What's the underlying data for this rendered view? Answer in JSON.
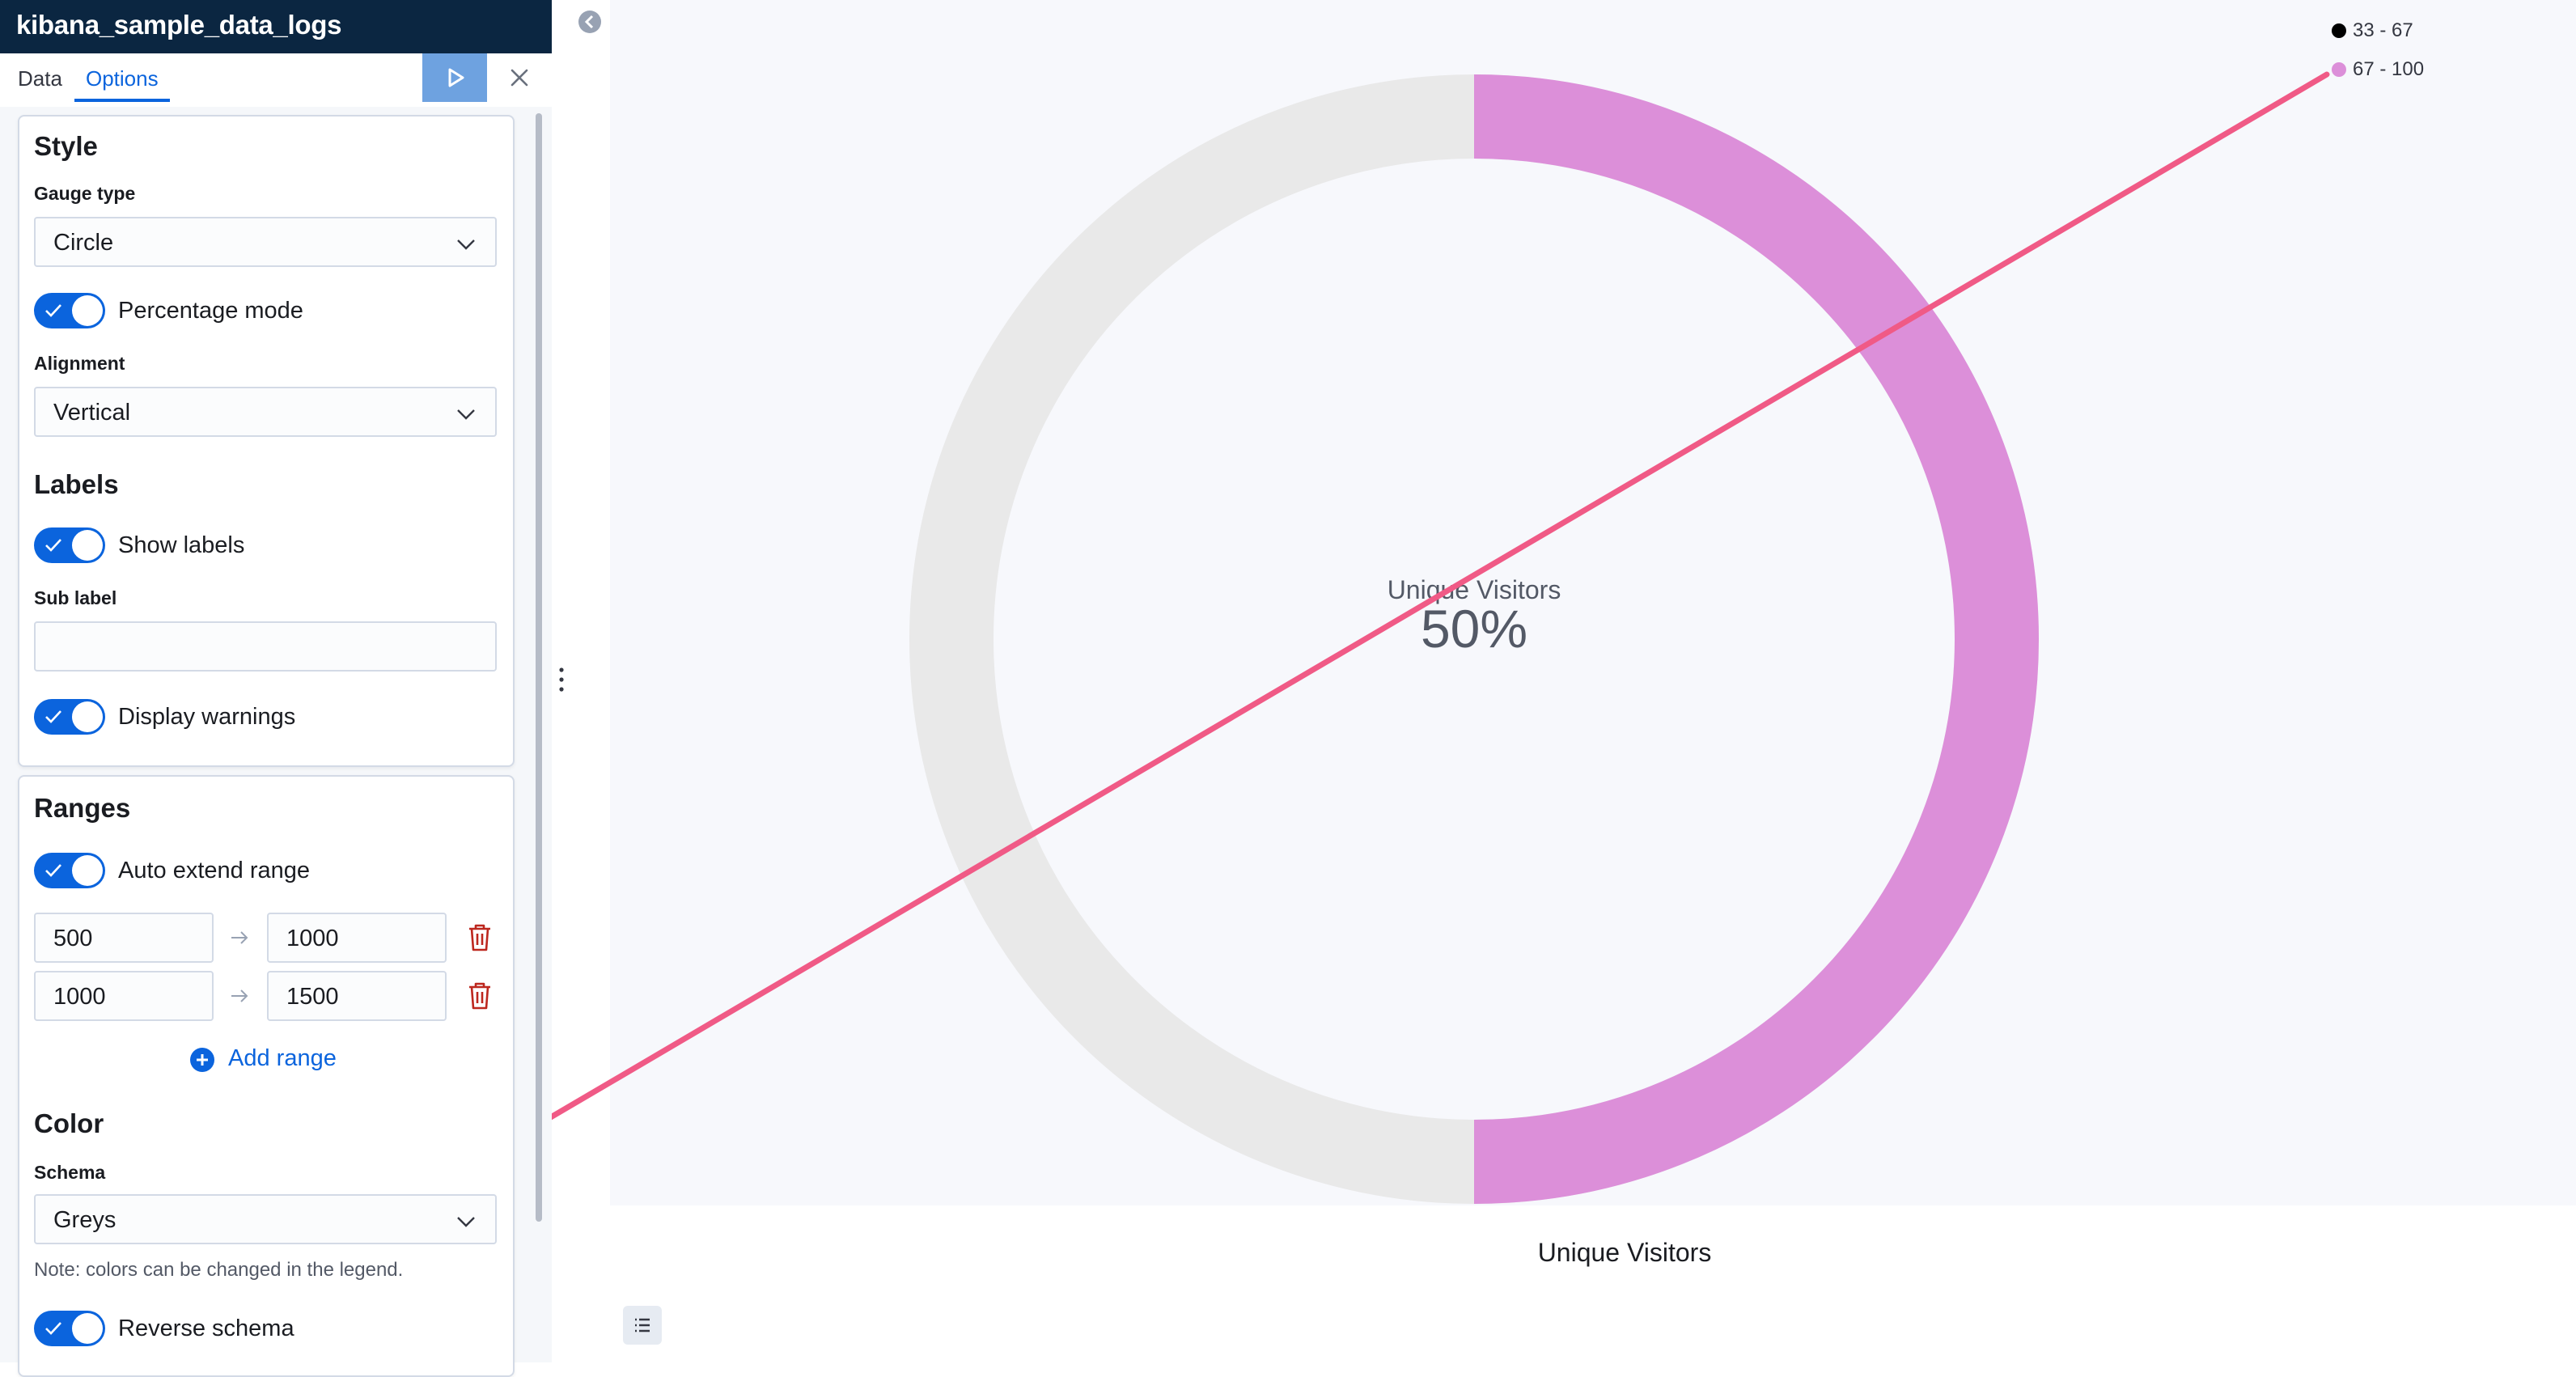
{
  "sidebar": {
    "index_pattern": "kibana_sample_data_logs",
    "tabs": [
      {
        "label": "Data"
      },
      {
        "label": "Options"
      }
    ],
    "active_tab": "Options",
    "style": {
      "title": "Style",
      "gauge_type_label": "Gauge type",
      "gauge_type_value": "Circle",
      "percentage_mode_label": "Percentage mode",
      "percentage_mode_on": true,
      "alignment_label": "Alignment",
      "alignment_value": "Vertical"
    },
    "labels": {
      "title": "Labels",
      "show_labels_label": "Show labels",
      "show_labels_on": true,
      "sub_label_label": "Sub label",
      "sub_label_value": "",
      "display_warnings_label": "Display warnings",
      "display_warnings_on": true
    },
    "ranges": {
      "title": "Ranges",
      "auto_extend_label": "Auto extend range",
      "auto_extend_on": true,
      "items": [
        {
          "from": "500",
          "to": "1000"
        },
        {
          "from": "1000",
          "to": "1500"
        }
      ],
      "add_range_label": "Add range"
    },
    "color": {
      "title": "Color",
      "schema_label": "Schema",
      "schema_value": "Greys",
      "note": "Note: colors can be changed in the legend.",
      "reverse_schema_label": "Reverse schema",
      "reverse_schema_on": true
    }
  },
  "gauge": {
    "label": "Unique Visitors",
    "value_text": "50%",
    "percent": 50,
    "caption": "Unique Visitors",
    "track_color": "#e9e9e9",
    "fill_color": "#dc8fd9",
    "background_color": "#f7f8fc"
  },
  "legend": [
    {
      "label": "33 - 67",
      "color": "#000000"
    },
    {
      "label": "67 - 100",
      "color": "#dc8fd9"
    }
  ],
  "annotation": {
    "type": "arrow",
    "color": "#f05a86"
  },
  "colors": {
    "accent": "#0b64dd",
    "header_bg": "#0b2641",
    "danger": "#bd271e"
  }
}
